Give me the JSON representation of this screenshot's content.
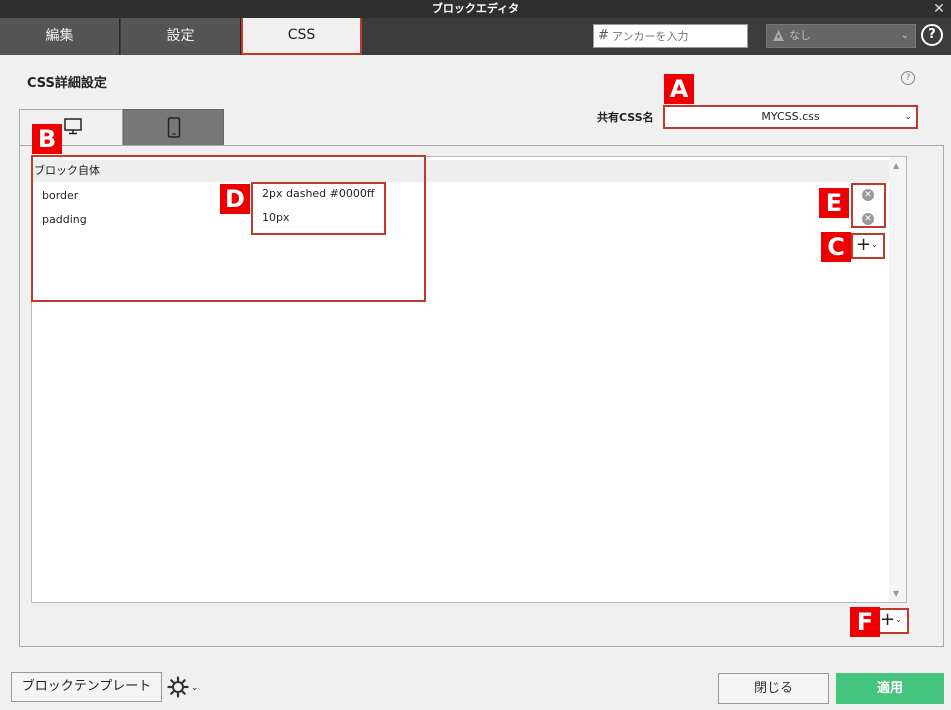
{
  "window": {
    "title": "ブロックエディタ",
    "close": "✕"
  },
  "tabs": [
    {
      "label": "編集"
    },
    {
      "label": "設定"
    },
    {
      "label": "CSS"
    }
  ],
  "header": {
    "anchor_placeholder": "アンカーを入力",
    "anchor_hash": "#",
    "select_value": "なし",
    "help": "?"
  },
  "css_section": {
    "title": "CSS詳細設定",
    "help": "?",
    "shared_css_label": "共有CSS名",
    "shared_css_value": "MYCSS.css"
  },
  "block": {
    "header": "ブロック自体",
    "properties": [
      {
        "name": "border",
        "value": "2px dashed #0000ff"
      },
      {
        "name": "padding",
        "value": "10px"
      }
    ]
  },
  "markers": [
    "A",
    "B",
    "C",
    "D",
    "E",
    "F"
  ],
  "footer": {
    "template_button": "ブロックテンプレート",
    "close_button": "閉じる",
    "apply_button": "適用"
  },
  "colors": {
    "highlight": "#c0392b",
    "marker": "#e00000",
    "apply": "#44c47c"
  }
}
